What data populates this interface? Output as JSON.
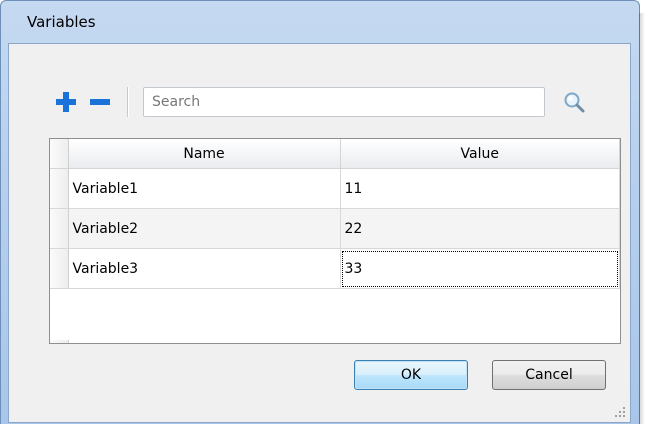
{
  "window": {
    "title": "Variables"
  },
  "toolbar": {
    "add_icon": "plus-icon",
    "remove_icon": "minus-icon",
    "search_placeholder": "Search",
    "search_value": "",
    "search_icon": "magnifier-icon",
    "accent_color": "#1a73d9"
  },
  "table": {
    "columns": [
      "Name",
      "Value"
    ],
    "rows": [
      {
        "name": "Variable1",
        "value": "11"
      },
      {
        "name": "Variable2",
        "value": "22"
      },
      {
        "name": "Variable3",
        "value": "33"
      }
    ],
    "focused_cell": "Value of Variable3"
  },
  "buttons": {
    "ok": "OK",
    "cancel": "Cancel"
  }
}
